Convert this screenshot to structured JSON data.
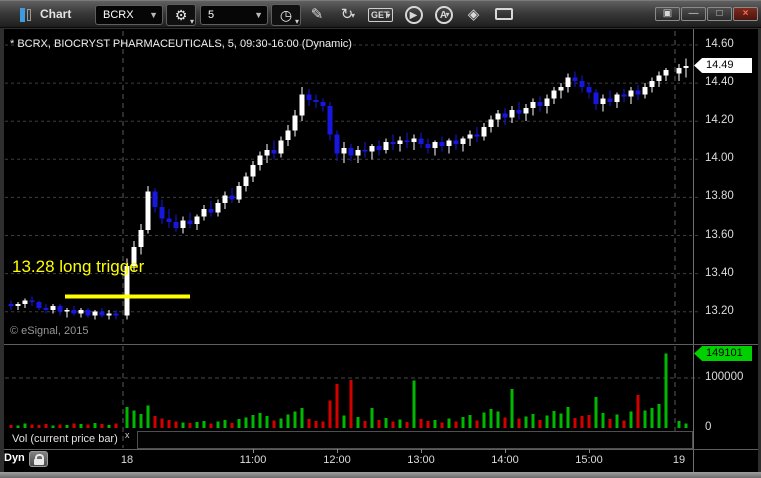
{
  "titlebar": {
    "title": "Chart",
    "symbol": "BCRX",
    "interval": "5",
    "symbol_settings_icon": "⚙",
    "interval_settings_icon": "◷",
    "icons": [
      {
        "name": "draw-pencil-icon",
        "glyph": "✎",
        "dropdown": false,
        "style": "plain"
      },
      {
        "name": "reload-refresh-icon",
        "glyph": "↻",
        "dropdown": true,
        "style": "plain"
      },
      {
        "name": "get-data-icon",
        "glyph": "GET",
        "dropdown": true,
        "style": "text"
      },
      {
        "name": "play-icon",
        "glyph": "▶",
        "dropdown": false,
        "style": "circle"
      },
      {
        "name": "auto-a-icon",
        "glyph": "A",
        "dropdown": true,
        "style": "circle"
      },
      {
        "name": "eraser-tool-icon",
        "glyph": "◈",
        "dropdown": false,
        "style": "plain"
      },
      {
        "name": "comment-bubble-icon",
        "glyph": "",
        "dropdown": false,
        "style": "bubble"
      }
    ],
    "window_buttons": [
      {
        "name": "popout-button",
        "glyph": "▣"
      },
      {
        "name": "minimize-button",
        "glyph": "—"
      },
      {
        "name": "maximize-button",
        "glyph": "□"
      },
      {
        "name": "close-button",
        "glyph": "×"
      }
    ]
  },
  "header_line": "* BCRX, BIOCRYST PHARMACEUTICALS, 5, 09:30-16:00 (Dynamic)",
  "watermark": "© eSignal, 2015",
  "annotation": {
    "text": "13.28 long trigger",
    "price": 13.28
  },
  "vol_label": {
    "text": "Vol (current price bar)",
    "close": "x"
  },
  "axes": {
    "price": {
      "ticks": [
        14.6,
        14.4,
        14.2,
        14.0,
        13.8,
        13.6,
        13.4,
        13.2
      ],
      "badge": "14.49"
    },
    "volume": {
      "ticks": [
        {
          "label": "100000",
          "value": 100000
        },
        {
          "label": "0",
          "value": 0
        }
      ],
      "badge": "149101"
    },
    "time": {
      "dyn": "Dyn",
      "labels": [
        {
          "text": "18",
          "gi": 16,
          "tick": false
        },
        {
          "text": "11:00",
          "gi": 34,
          "tick": true
        },
        {
          "text": "12:00",
          "gi": 46,
          "tick": true
        },
        {
          "text": "13:00",
          "gi": 58,
          "tick": true
        },
        {
          "text": "14:00",
          "gi": 70,
          "tick": true
        },
        {
          "text": "15:00",
          "gi": 82,
          "tick": true
        },
        {
          "text": "19",
          "gi": 94,
          "tick": false
        }
      ]
    }
  },
  "chart_data": {
    "type": "candlestick",
    "symbol": "BCRX",
    "company": "BIOCRYST PHARMACEUTICALS",
    "interval_minutes": 5,
    "session": "09:30-16:00",
    "mode": "Dynamic",
    "last_price": 14.49,
    "last_volume": 149101,
    "price_axis": {
      "max": 14.6,
      "min": 13.2,
      "tick_step": 0.2
    },
    "volume_axis": {
      "gridline": 100000,
      "min": 0
    },
    "trigger": {
      "price": 13.28,
      "text": "13.28 long trigger"
    },
    "colors": {
      "up": "#ffffff",
      "down": "#1717e0",
      "vol_up": "#00b800",
      "vol_down": "#d40000",
      "trigger": "#ffff00"
    },
    "days": [
      {
        "label": "",
        "bars": [
          [
            13.24,
            13.26,
            13.21,
            13.23,
            6000
          ],
          [
            13.23,
            13.25,
            13.21,
            13.24,
            5000
          ],
          [
            13.24,
            13.27,
            13.22,
            13.26,
            9000
          ],
          [
            13.26,
            13.28,
            13.23,
            13.25,
            7000
          ],
          [
            13.25,
            13.26,
            13.21,
            13.22,
            6000
          ],
          [
            13.22,
            13.24,
            13.19,
            13.21,
            8000
          ],
          [
            13.21,
            13.24,
            13.19,
            13.23,
            5000
          ],
          [
            13.23,
            13.24,
            13.18,
            13.2,
            7000
          ],
          [
            13.2,
            13.22,
            13.17,
            13.21,
            6000
          ],
          [
            13.21,
            13.23,
            13.18,
            13.19,
            9000
          ],
          [
            13.19,
            13.22,
            13.17,
            13.21,
            8000
          ],
          [
            13.21,
            13.22,
            13.17,
            13.18,
            7000
          ],
          [
            13.18,
            13.21,
            13.16,
            13.2,
            10000
          ],
          [
            13.2,
            13.22,
            13.17,
            13.18,
            8000
          ],
          [
            13.18,
            13.21,
            13.16,
            13.19,
            6000
          ],
          [
            13.19,
            13.21,
            13.16,
            13.18,
            9000
          ]
        ]
      },
      {
        "label": "18",
        "bars": [
          [
            13.18,
            13.48,
            13.16,
            13.44,
            42000
          ],
          [
            13.44,
            13.57,
            13.41,
            13.54,
            35000
          ],
          [
            13.54,
            13.66,
            13.5,
            13.63,
            28000
          ],
          [
            13.63,
            13.86,
            13.61,
            13.83,
            45000
          ],
          [
            13.83,
            13.85,
            13.72,
            13.75,
            24000
          ],
          [
            13.75,
            13.79,
            13.66,
            13.69,
            19000
          ],
          [
            13.69,
            13.74,
            13.64,
            13.67,
            16000
          ],
          [
            13.67,
            13.71,
            13.62,
            13.64,
            13000
          ],
          [
            13.64,
            13.7,
            13.61,
            13.68,
            11000
          ],
          [
            13.68,
            13.72,
            13.64,
            13.66,
            10000
          ],
          [
            13.66,
            13.71,
            13.63,
            13.7,
            12000
          ],
          [
            13.7,
            13.76,
            13.68,
            13.74,
            14000
          ],
          [
            13.74,
            13.78,
            13.7,
            13.72,
            9000
          ],
          [
            13.72,
            13.79,
            13.7,
            13.77,
            13000
          ],
          [
            13.77,
            13.83,
            13.74,
            13.81,
            16000
          ],
          [
            13.81,
            13.85,
            13.77,
            13.79,
            10000
          ],
          [
            13.79,
            13.88,
            13.77,
            13.86,
            18000
          ],
          [
            13.86,
            13.93,
            13.83,
            13.91,
            21000
          ],
          [
            13.91,
            13.99,
            13.88,
            13.97,
            26000
          ],
          [
            13.97,
            14.04,
            13.94,
            14.02,
            30000
          ],
          [
            14.02,
            14.08,
            13.98,
            14.05,
            24000
          ],
          [
            14.05,
            14.1,
            14.0,
            14.03,
            15000
          ],
          [
            14.03,
            14.12,
            14.01,
            14.1,
            19000
          ],
          [
            14.1,
            14.18,
            14.07,
            14.15,
            27000
          ],
          [
            14.15,
            14.26,
            14.12,
            14.23,
            33000
          ],
          [
            14.23,
            14.38,
            14.2,
            14.34,
            40000
          ],
          [
            14.34,
            14.37,
            14.28,
            14.31,
            18000
          ],
          [
            14.31,
            14.34,
            14.27,
            14.3,
            14000
          ],
          [
            14.3,
            14.32,
            14.25,
            14.28,
            13000
          ],
          [
            14.28,
            14.3,
            14.1,
            14.13,
            55000
          ],
          [
            14.13,
            14.15,
            13.99,
            14.03,
            88000
          ],
          [
            14.03,
            14.09,
            13.98,
            14.06,
            25000
          ],
          [
            14.06,
            14.08,
            13.99,
            14.02,
            96000
          ],
          [
            14.02,
            14.07,
            13.98,
            14.05,
            22000
          ],
          [
            14.05,
            14.09,
            14.01,
            14.04,
            14000
          ],
          [
            14.04,
            14.08,
            14.0,
            14.07,
            40000
          ],
          [
            14.07,
            14.1,
            14.02,
            14.05,
            16000
          ],
          [
            14.05,
            14.11,
            14.03,
            14.09,
            20000
          ],
          [
            14.09,
            14.13,
            14.05,
            14.08,
            13000
          ],
          [
            14.08,
            14.12,
            14.04,
            14.1,
            17000
          ],
          [
            14.1,
            14.14,
            14.06,
            14.09,
            12000
          ],
          [
            14.09,
            14.13,
            14.05,
            14.11,
            95000
          ],
          [
            14.11,
            14.14,
            14.06,
            14.08,
            18000
          ],
          [
            14.08,
            14.11,
            14.03,
            14.06,
            14000
          ],
          [
            14.06,
            14.1,
            14.02,
            14.09,
            16000
          ],
          [
            14.09,
            14.12,
            14.04,
            14.07,
            11000
          ],
          [
            14.07,
            14.11,
            14.03,
            14.1,
            19000
          ],
          [
            14.1,
            14.13,
            14.05,
            14.08,
            13000
          ],
          [
            14.08,
            14.12,
            14.04,
            14.11,
            22000
          ],
          [
            14.11,
            14.15,
            14.07,
            14.13,
            26000
          ],
          [
            14.13,
            14.17,
            14.09,
            14.12,
            15000
          ],
          [
            14.12,
            14.19,
            14.1,
            14.17,
            31000
          ],
          [
            14.17,
            14.23,
            14.14,
            14.21,
            38000
          ],
          [
            14.21,
            14.26,
            14.17,
            14.24,
            33000
          ],
          [
            14.24,
            14.27,
            14.18,
            14.22,
            21000
          ],
          [
            14.22,
            14.28,
            14.19,
            14.26,
            78000
          ],
          [
            14.26,
            14.3,
            14.21,
            14.24,
            19000
          ],
          [
            14.24,
            14.29,
            14.2,
            14.27,
            23000
          ],
          [
            14.27,
            14.32,
            14.23,
            14.3,
            28000
          ],
          [
            14.3,
            14.33,
            14.25,
            14.28,
            16000
          ],
          [
            14.28,
            14.34,
            14.24,
            14.32,
            25000
          ],
          [
            14.32,
            14.38,
            14.29,
            14.36,
            34000
          ],
          [
            14.36,
            14.4,
            14.32,
            14.38,
            29000
          ],
          [
            14.38,
            14.45,
            14.35,
            14.43,
            42000
          ],
          [
            14.43,
            14.46,
            14.38,
            14.41,
            20000
          ],
          [
            14.41,
            14.44,
            14.35,
            14.38,
            24000
          ],
          [
            14.38,
            14.4,
            14.32,
            14.35,
            26000
          ],
          [
            14.35,
            14.37,
            14.26,
            14.29,
            62000,
            "g"
          ],
          [
            14.29,
            14.34,
            14.25,
            14.32,
            30000
          ],
          [
            14.32,
            14.36,
            14.28,
            14.3,
            18000
          ],
          [
            14.3,
            14.35,
            14.27,
            14.34,
            27000
          ],
          [
            14.34,
            14.37,
            14.3,
            14.33,
            15000
          ],
          [
            14.33,
            14.38,
            14.29,
            14.36,
            33000
          ],
          [
            14.36,
            14.39,
            14.31,
            14.34,
            66000
          ],
          [
            14.34,
            14.4,
            14.32,
            14.38,
            35000
          ],
          [
            14.38,
            14.43,
            14.35,
            14.41,
            40000
          ],
          [
            14.41,
            14.46,
            14.38,
            14.44,
            48000
          ],
          [
            14.44,
            14.48,
            14.41,
            14.47,
            149101
          ]
        ]
      },
      {
        "label": "19",
        "bars": [
          [
            14.45,
            14.5,
            14.41,
            14.48,
            14000
          ],
          [
            14.48,
            14.53,
            14.43,
            14.49,
            9000
          ]
        ]
      }
    ]
  }
}
